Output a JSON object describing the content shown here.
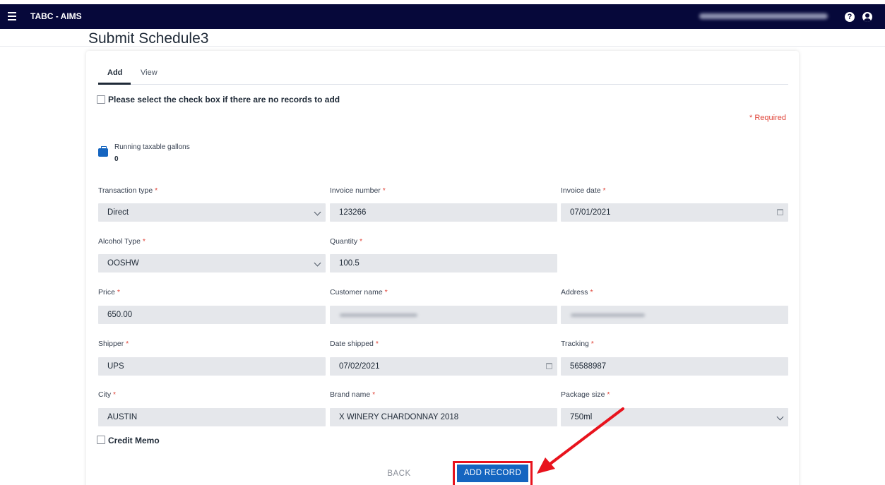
{
  "header": {
    "app_title": "TABC - AIMS",
    "help_icon_glyph": "?"
  },
  "page": {
    "title": "Submit Schedule3"
  },
  "tabs": [
    {
      "label": "Add",
      "active": true
    },
    {
      "label": "View",
      "active": false
    }
  ],
  "no_records_checkbox": {
    "label": "Please select the check box if there are no records to add",
    "checked": false
  },
  "required_note": "* Required",
  "running_gallons": {
    "label": "Running taxable gallons",
    "value": "0"
  },
  "fields": {
    "transaction_type": {
      "label": "Transaction type",
      "value": "Direct"
    },
    "invoice_number": {
      "label": "Invoice number",
      "value": "123266"
    },
    "invoice_date": {
      "label": "Invoice date",
      "value": "07/01/2021"
    },
    "alcohol_type": {
      "label": "Alcohol Type",
      "value": "OOSHW"
    },
    "quantity": {
      "label": "Quantity",
      "value": "100.5"
    },
    "price": {
      "label": "Price",
      "value": "650.00"
    },
    "customer_name": {
      "label": "Customer name",
      "value": ""
    },
    "address": {
      "label": "Address",
      "value": ""
    },
    "shipper": {
      "label": "Shipper",
      "value": "UPS"
    },
    "date_shipped": {
      "label": "Date shipped",
      "value": "07/02/2021"
    },
    "tracking": {
      "label": "Tracking",
      "value": "56588987"
    },
    "city": {
      "label": "City",
      "value": "AUSTIN"
    },
    "brand_name": {
      "label": "Brand name",
      "value": "X WINERY CHARDONNAY 2018"
    },
    "package_size": {
      "label": "Package size",
      "value": "750ml"
    }
  },
  "credit_memo": {
    "label": "Credit Memo",
    "checked": false
  },
  "actions": {
    "back_label": "BACK",
    "add_record_label": "ADD RECORD"
  },
  "colors": {
    "topbar": "#06083a",
    "primary_button": "#1565c0",
    "required": "#e0453a",
    "annotation": "#e8131d"
  }
}
